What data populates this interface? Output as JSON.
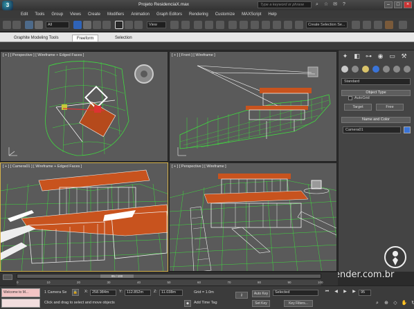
{
  "window": {
    "title": "Projeto ResidenciaX.max",
    "search_placeholder": "Type a keyword or phrase"
  },
  "menu": {
    "items": [
      "Edit",
      "Tools",
      "Group",
      "Views",
      "Create",
      "Modifiers",
      "Animation",
      "Graph Editors",
      "Rendering",
      "Customize",
      "MAXScript",
      "Help"
    ]
  },
  "toolbar": {
    "selection_filter": "All",
    "view_label": "View",
    "named_selection_placeholder": "Create Selection Se..."
  },
  "ribbon": {
    "tabs": [
      "Graphite Modeling Tools",
      "Freeform",
      "Selection"
    ]
  },
  "viewports": {
    "top_left": "[ + ] [ Perspective ] [ Wireframe + Edged Faces ]",
    "top_right": "[ + ] [ Front ] [ Wireframe ]",
    "bottom_left": "[ + ] [ Camera01 ] [ Wireframe + Edged Faces ]",
    "bottom_right": "[ + ] [ Perspective ] [ Wireframe ]"
  },
  "command_panel": {
    "tab_icons": [
      "create-icon",
      "modify-icon",
      "hierarchy-icon",
      "motion-icon",
      "display-icon",
      "utilities-icon"
    ],
    "category": "Standard",
    "object_type_header": "Object Type",
    "autogrid_label": "AutoGrid",
    "target_button": "Target",
    "free_button": "Free",
    "name_color_header": "Name and Color",
    "object_name": "Camera01",
    "object_color": "#3a74d8"
  },
  "timeline": {
    "frame_display": "95 / 100",
    "ruler_ticks": [
      "0",
      "10",
      "20",
      "30",
      "40",
      "50",
      "60",
      "70",
      "80",
      "90",
      "100"
    ]
  },
  "status": {
    "maxscript_text": "Welcome to M...",
    "selected_count": "1 Camera Se",
    "prompt": "Click and drag to select and move objects",
    "x": "258.984m",
    "y": "112.852m",
    "z": "11.038m",
    "grid": "Grid = 1.0m",
    "add_time_tag": "Add Time Tag",
    "auto_key": "Auto Key",
    "set_key": "Set Key",
    "key_mode": "Selected",
    "key_filters": "Key Filters...",
    "current_frame": "95"
  },
  "watermark": "render.com.br",
  "colors": {
    "wire_green": "#3fdc3f",
    "wire_white": "#f2f2f2",
    "roof_orange": "#c8531e",
    "active_border": "#d6b24a"
  }
}
